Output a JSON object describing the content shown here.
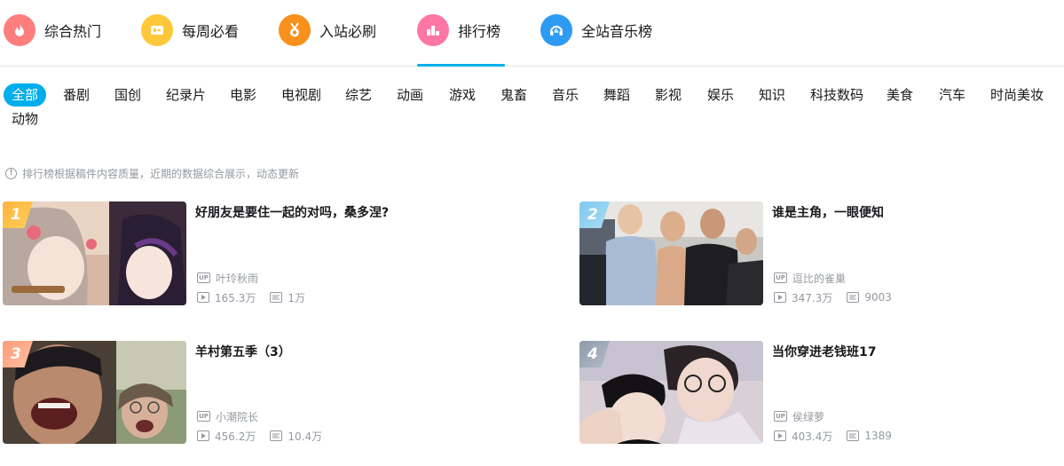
{
  "colors": {
    "accent": "#00aeec",
    "hot": "#fe7d7d",
    "weekly": "#ffc83a",
    "must": "#f8911b",
    "rank": "#fe76a3",
    "music": "#2e9bf3"
  },
  "top_nav": [
    {
      "label": "综合热门",
      "icon": "flame-icon"
    },
    {
      "label": "每周必看",
      "icon": "ticket-icon"
    },
    {
      "label": "入站必刷",
      "icon": "medal-icon"
    },
    {
      "label": "排行榜",
      "icon": "podium-icon",
      "active": true
    },
    {
      "label": "全站音乐榜",
      "icon": "headphones-icon"
    }
  ],
  "categories": [
    "全部",
    "番剧",
    "国创",
    "纪录片",
    "电影",
    "电视剧",
    "综艺",
    "动画",
    "游戏",
    "鬼畜",
    "音乐",
    "舞蹈",
    "影视",
    "娱乐",
    "知识",
    "科技数码",
    "美食",
    "汽车",
    "时尚美妆",
    "动物"
  ],
  "selected_category": "全部",
  "notice": "排行榜根据稿件内容质量，近期的数据综合展示，动态更新",
  "notice_icon": "!",
  "up_badge": "UP",
  "videos": [
    {
      "rank": "1",
      "title": "好朋友是要住一起的对吗，桑多涅?",
      "up": "叶玲秋雨",
      "plays": "165.3万",
      "danmaku": "1万"
    },
    {
      "rank": "2",
      "title": "谁是主角，一眼便知",
      "up": "逗比的雀巢",
      "plays": "347.3万",
      "danmaku": "9003"
    },
    {
      "rank": "3",
      "title": "羊村第五季（3）",
      "up": "小潮院长",
      "plays": "456.2万",
      "danmaku": "10.4万"
    },
    {
      "rank": "4",
      "title": "当你穿进老钱班17",
      "up": "侯绿萝",
      "plays": "403.4万",
      "danmaku": "1389"
    }
  ]
}
